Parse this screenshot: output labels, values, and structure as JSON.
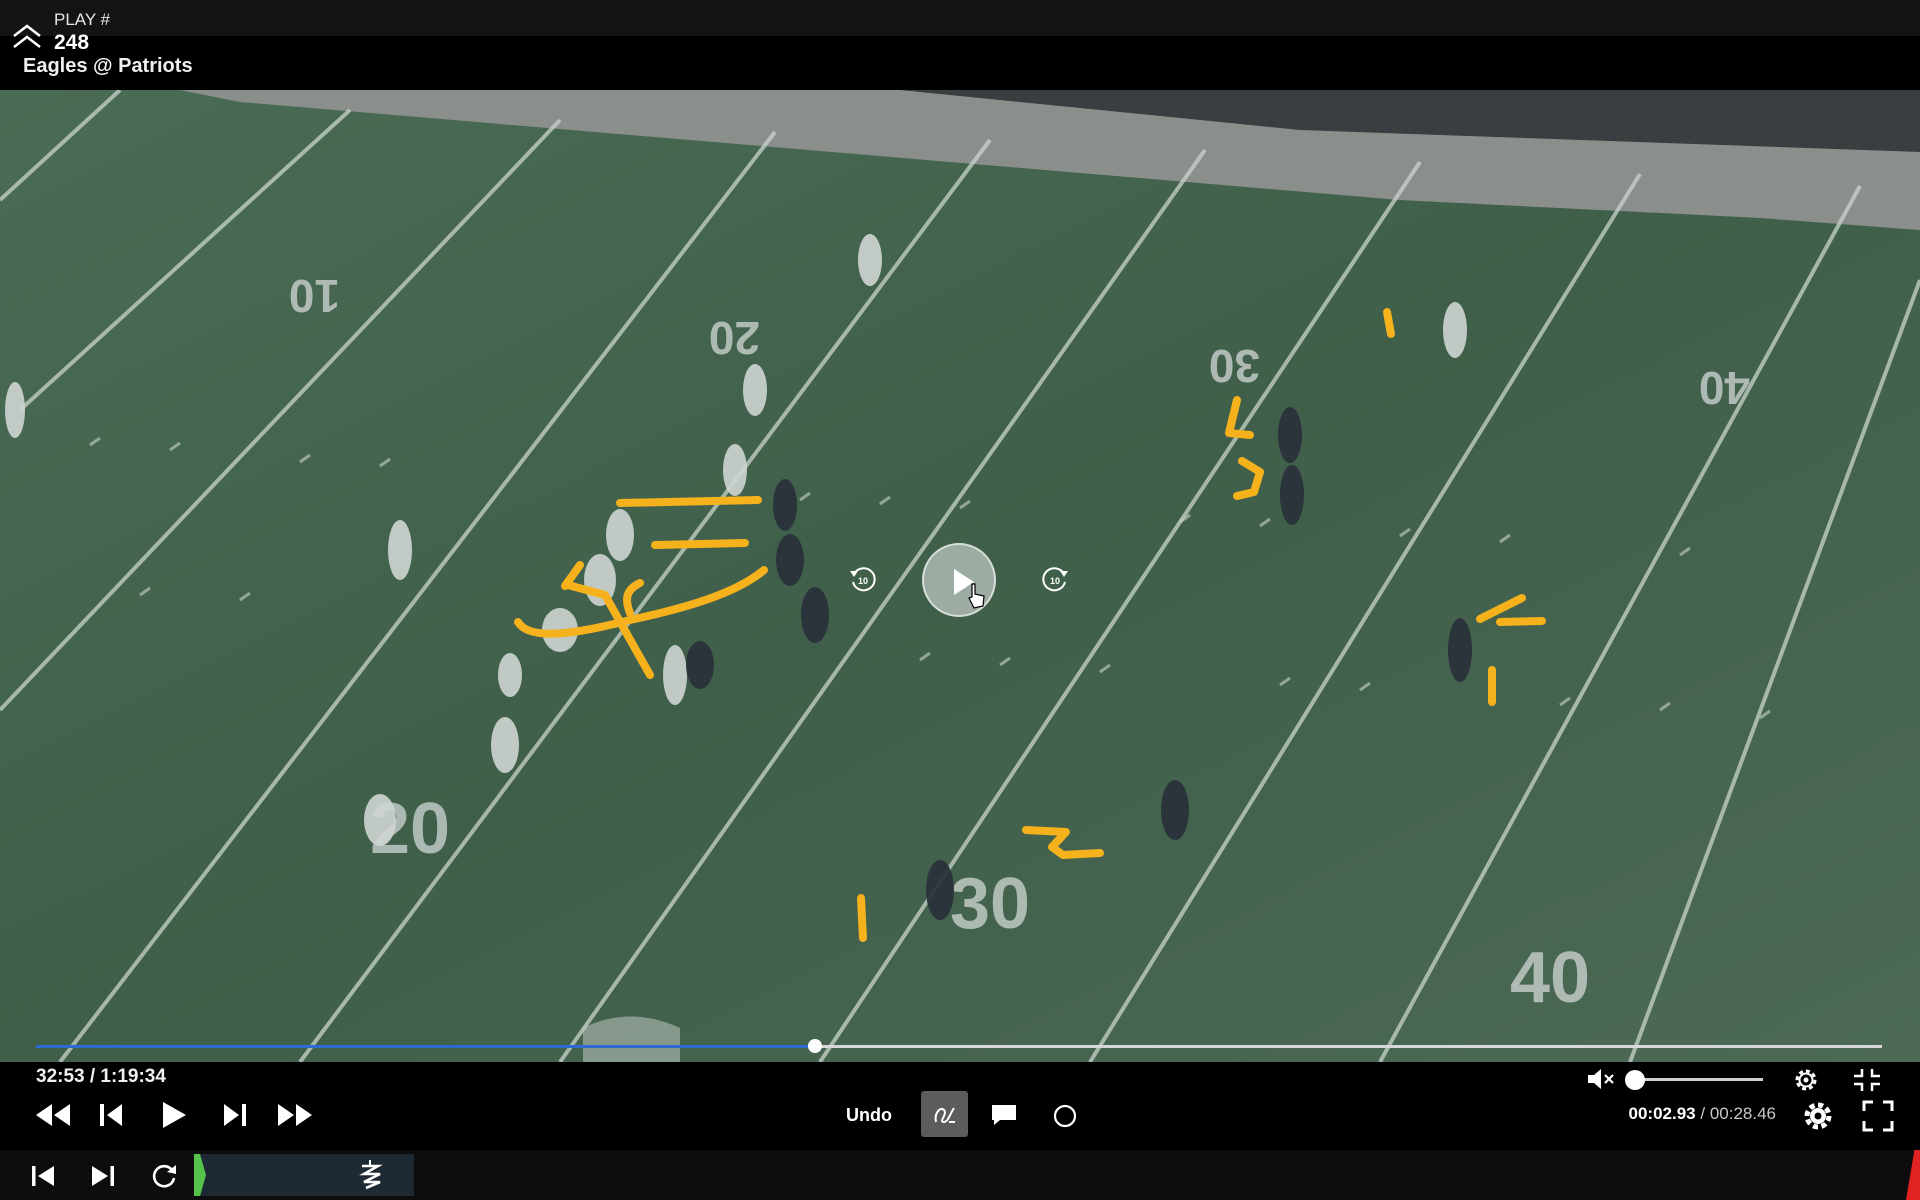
{
  "header": {
    "play_label": "PLAY #",
    "play_number": "248",
    "matchup": "Eagles @ Patriots"
  },
  "video": {
    "field_numbers": [
      "10",
      "20",
      "30",
      "40",
      "20",
      "30",
      "40"
    ],
    "rewind_seconds": "10",
    "forward_seconds": "10",
    "progress": 0.422
  },
  "controls": {
    "timecode": "32:53 / 1:19:34",
    "undo_label": "Undo",
    "clip_current": "00:02.93",
    "clip_separator": " / ",
    "clip_total": "00:28.46",
    "volume_level": 0.0
  },
  "colors": {
    "telestrator": "#f5b21c",
    "progress": "#2f6ad0",
    "segment": "#55c24a",
    "alert": "#e02222"
  },
  "icons": [
    "chevron-up-icon",
    "rewind-icon",
    "step-back-icon",
    "play-icon",
    "step-forward-icon",
    "fast-forward-icon",
    "pen-icon",
    "comment-icon",
    "circle-icon",
    "mute-icon",
    "settings-icon",
    "fullscreen-exit-icon",
    "fullscreen-icon",
    "skip-start-icon",
    "skip-end-icon",
    "replay-icon",
    "squiggle-icon"
  ]
}
